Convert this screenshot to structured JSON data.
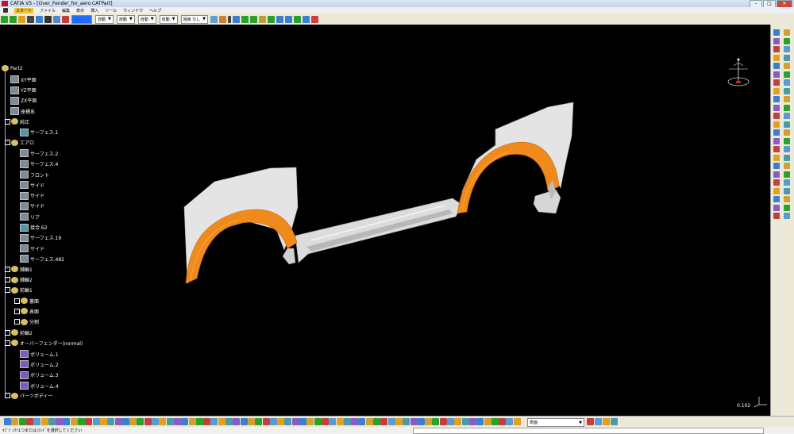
{
  "window": {
    "title": "CATIA V5 - [Over_Fender_for_aero.CATPart]"
  },
  "menu": {
    "items": [
      "スタート",
      "ファイル",
      "編集",
      "表示",
      "挿入",
      "ツール",
      "ウィンドウ",
      "ヘルプ"
    ]
  },
  "toolbar": {
    "color_select": "",
    "line_select1": "自動",
    "line_select2": "自動",
    "line_select3": "自動",
    "line_select4": "自動",
    "layer_select": "なし",
    "layer_prefix": "回線"
  },
  "tree": {
    "root": "Part2",
    "items": [
      {
        "label": "XY平面",
        "type": "plane",
        "level": 1
      },
      {
        "label": "YZ平面",
        "type": "plane",
        "level": 1
      },
      {
        "label": "ZX平面",
        "type": "plane",
        "level": 1
      },
      {
        "label": "座標系",
        "type": "axis",
        "level": 1
      },
      {
        "label": "純正",
        "type": "set",
        "level": 1
      },
      {
        "label": "サーフェス.1",
        "type": "surface",
        "level": 2
      },
      {
        "label": "エアロ",
        "type": "set",
        "level": 1
      },
      {
        "label": "サーフェス.2",
        "type": "plane",
        "level": 2
      },
      {
        "label": "サーフェス.4",
        "type": "plane",
        "level": 2
      },
      {
        "label": "フロント",
        "type": "plane",
        "level": 2
      },
      {
        "label": "サイド",
        "type": "plane",
        "level": 2
      },
      {
        "label": "サイド",
        "type": "plane",
        "level": 2
      },
      {
        "label": "サイド",
        "type": "plane",
        "level": 2
      },
      {
        "label": "リア",
        "type": "plane",
        "level": 2
      },
      {
        "label": "接合.62",
        "type": "join",
        "level": 2
      },
      {
        "label": "サーフェス.19",
        "type": "plane",
        "level": 2
      },
      {
        "label": "サイド",
        "type": "plane",
        "level": 2
      },
      {
        "label": "サーフェス.482",
        "type": "plane",
        "level": 2
      },
      {
        "label": "舗輪1",
        "type": "set",
        "level": 1
      },
      {
        "label": "舗輪2",
        "type": "set",
        "level": 1
      },
      {
        "label": "前輪1",
        "type": "set",
        "level": 1
      },
      {
        "label": "裏面",
        "type": "set",
        "level": 2
      },
      {
        "label": "表面",
        "type": "set",
        "level": 2
      },
      {
        "label": "分割",
        "type": "set",
        "level": 2
      },
      {
        "label": "前輪2",
        "type": "set",
        "level": 1
      },
      {
        "label": "オーバーフェンダー(normal)",
        "type": "set",
        "level": 1
      },
      {
        "label": "ボリューム.1",
        "type": "volume",
        "level": 2
      },
      {
        "label": "ボリューム.2",
        "type": "volume",
        "level": 2
      },
      {
        "label": "ボリューム.3",
        "type": "volume",
        "level": 2
      },
      {
        "label": "ボリューム.4",
        "type": "volume",
        "level": 2
      },
      {
        "label": "パーツボディー",
        "type": "set",
        "level": 1
      }
    ]
  },
  "viewport": {
    "scale": "0.102"
  },
  "bottombar": {
    "view_select": "表面"
  },
  "status": {
    "text": "ｵﾌﾞｼﾞｪｸﾄ1つまたはｺﾏﾝﾄﾞを選択してください"
  },
  "colors": {
    "accent_orange": "#f08a1c",
    "part_white": "#e4e4e4",
    "bg": "#000000"
  }
}
